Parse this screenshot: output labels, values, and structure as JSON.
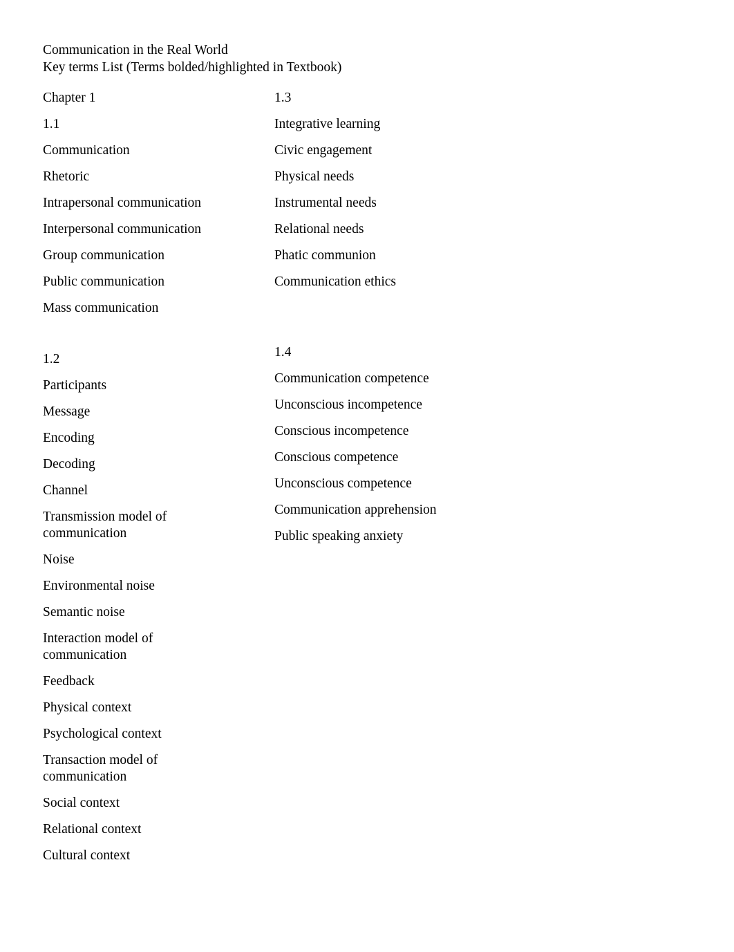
{
  "document": {
    "title_line_1": "Communication in the Real World",
    "title_line_2": "Key terms List (Terms bolded/highlighted in Textbook)"
  },
  "left_column": {
    "chapter_heading": "Chapter 1",
    "section_1_1": {
      "number": "1.1",
      "terms": [
        "Communication",
        "Rhetoric",
        "Intrapersonal communication",
        "Interpersonal communication",
        "Group communication",
        "Public communication",
        "Mass communication"
      ]
    },
    "section_1_2": {
      "number": "1.2",
      "terms": [
        "Participants",
        "Message",
        "Encoding",
        "Decoding",
        "Channel",
        "Transmission model of communication",
        "Noise",
        "Environmental noise",
        "Semantic noise",
        "Interaction model of communication",
        "Feedback",
        "Physical context",
        "Psychological context",
        "Transaction model of communication",
        "Social context",
        "Relational context",
        "Cultural context"
      ]
    }
  },
  "right_column": {
    "section_1_3": {
      "number": "1.3",
      "terms": [
        "Integrative learning",
        "Civic engagement",
        "Physical needs",
        "Instrumental needs",
        "Relational needs",
        "Phatic communion",
        "Communication ethics"
      ]
    },
    "section_1_4": {
      "number": "1.4",
      "terms": [
        "Communication competence",
        "Unconscious incompetence",
        "Conscious incompetence",
        "Conscious competence",
        "Unconscious competence",
        "Communication apprehension",
        "Public speaking anxiety"
      ]
    }
  }
}
